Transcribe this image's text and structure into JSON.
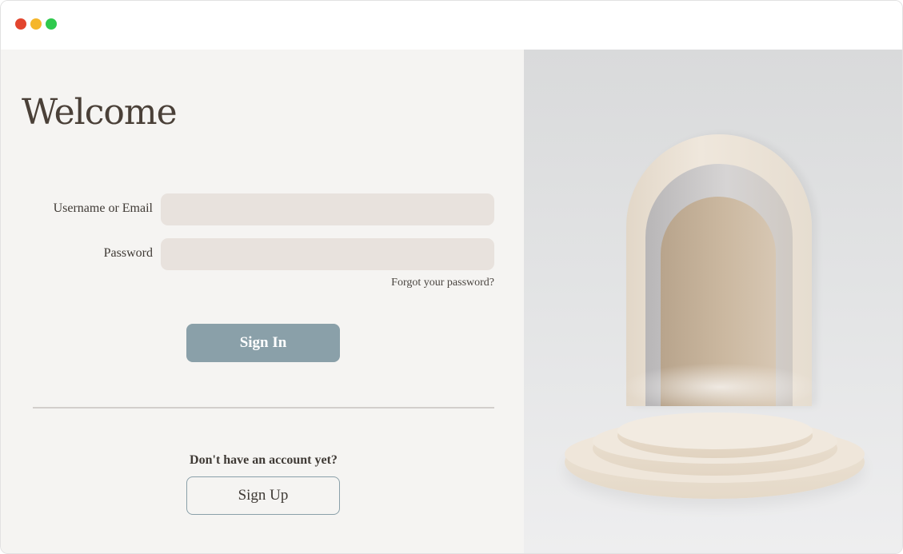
{
  "window": {
    "controls": {
      "close_color": "#e2452e",
      "minimize_color": "#f5b62a",
      "maximize_color": "#2fc94d"
    }
  },
  "login": {
    "heading": "Welcome",
    "username_label": "Username or Email",
    "username_value": "",
    "password_label": "Password",
    "password_value": "",
    "forgot_link": "Forgot your password?",
    "sign_in_button": "Sign In",
    "no_account_text": "Don't have an account yet?",
    "sign_up_button": "Sign Up"
  },
  "colors": {
    "panel_background": "#f5f4f2",
    "input_background": "#e8e2dd",
    "accent": "#8aa0a9",
    "text": "#3f3a35"
  },
  "illustration": {
    "subject": "beige arches with round tiered podium"
  }
}
